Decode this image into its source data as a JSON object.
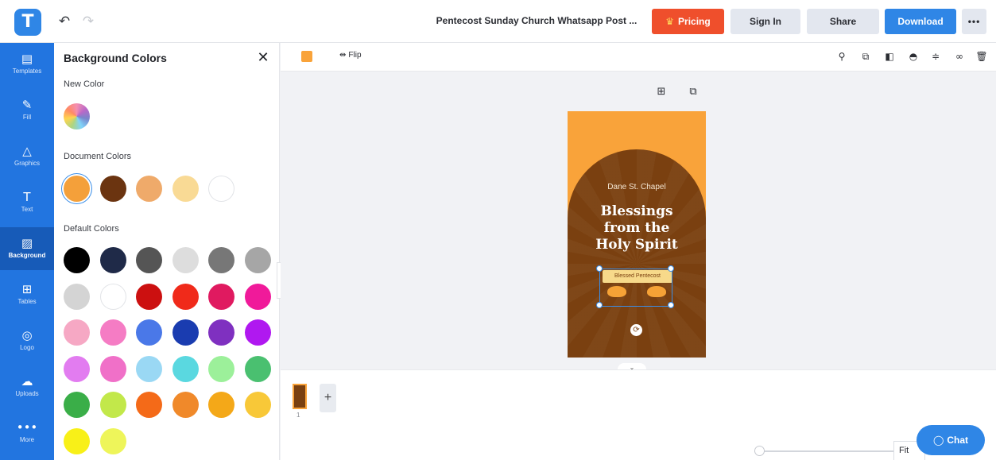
{
  "app": {
    "logo_letter": "T",
    "doc_title": "Pentecost Sunday Church Whatsapp Post ...",
    "undo_glyph": "↶",
    "redo_glyph": "↷"
  },
  "header": {
    "pricing_label": "Pricing",
    "pricing_icon": "♛",
    "signin_label": "Sign In",
    "share_label": "Share",
    "download_label": "Download",
    "more_label": "•••"
  },
  "rail": {
    "items": [
      {
        "label": "Templates",
        "icon": "▤"
      },
      {
        "label": "Fill",
        "icon": "✎"
      },
      {
        "label": "Graphics",
        "icon": "△"
      },
      {
        "label": "Text",
        "icon": "T"
      },
      {
        "label": "Background",
        "icon": "▨"
      },
      {
        "label": "Tables",
        "icon": "⊞"
      },
      {
        "label": "Logo",
        "icon": "◎"
      },
      {
        "label": "Uploads",
        "icon": "☁"
      },
      {
        "label": "More",
        "icon": "•••"
      }
    ]
  },
  "panel": {
    "title": "Background Colors",
    "close_glyph": "✕",
    "new_color_label": "New Color",
    "document_colors_label": "Document Colors",
    "default_colors_label": "Default Colors",
    "collapse_glyph": "‹",
    "document_colors": [
      "#f4a03a",
      "#6b3410",
      "#efaa6a",
      "#f9da95",
      "#ffffff"
    ],
    "default_colors": [
      "#000000",
      "#1f2a48",
      "#555555",
      "#dddddd",
      "#777777",
      "#a6a6a6",
      "#d4d4d4",
      "#ffffff",
      "#cc1010",
      "#f02a1a",
      "#e01a60",
      "#f01a9a",
      "#f6a8c4",
      "#f57cc4",
      "#4a78e8",
      "#1a3cb0",
      "#7f30c0",
      "#b018f0",
      "#e27cf0",
      "#f070c8",
      "#9ad8f4",
      "#5ad8e0",
      "#9cf09a",
      "#4ac070",
      "#3aae48",
      "#c2e84a",
      "#f46a18",
      "#f0892a",
      "#f4a818",
      "#f8c838",
      "#f8f018",
      "#eef55a"
    ]
  },
  "toolbar": {
    "fill_color": "#f9a33a",
    "flip_glyph": "⇹",
    "flip_label": "Flip",
    "icons": [
      {
        "name": "paint-format-icon",
        "glyph": "⚲"
      },
      {
        "name": "duplicate-icon",
        "glyph": "⧉"
      },
      {
        "name": "layer-icon",
        "glyph": "◧"
      },
      {
        "name": "opacity-icon",
        "glyph": "◓"
      },
      {
        "name": "align-icon",
        "glyph": "≑"
      },
      {
        "name": "link-icon",
        "glyph": "∞"
      },
      {
        "name": "delete-icon",
        "glyph": "🗑"
      }
    ]
  },
  "canvas": {
    "add_page_glyph": "⊞",
    "copy_page_glyph": "⧉",
    "poster": {
      "chapel": "Dane St. Chapel",
      "headline_lines": [
        "Blessings",
        "from the",
        "Holy Spirit"
      ],
      "banner": "Blessed Pentecost",
      "bg_color": "#7a4010",
      "accent_color": "#f9a33a",
      "rotate_glyph": "⟳"
    },
    "collapse_glyph": "⌄"
  },
  "pages": {
    "page_number": "1",
    "add_glyph": "+"
  },
  "zoom": {
    "level_label": "Fit",
    "slider_fraction": 0.02
  },
  "chat": {
    "label": "Chat",
    "icon": "◯"
  }
}
